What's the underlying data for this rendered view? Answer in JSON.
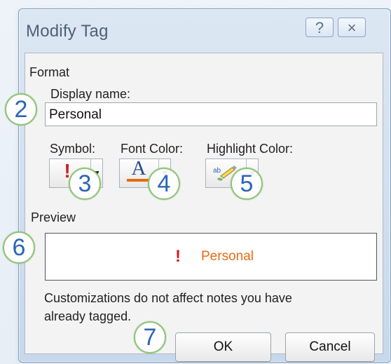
{
  "dialog": {
    "title": "Modify Tag",
    "help_label": "?",
    "close_label": "×"
  },
  "format": {
    "section_label": "Format",
    "display_name_label": "Display name:",
    "display_name_value": "Personal",
    "symbol_label": "Symbol:",
    "font_color_label": "Font Color:",
    "highlight_color_label": "Highlight Color:"
  },
  "preview": {
    "section_label": "Preview",
    "symbol": "!",
    "text": "Personal"
  },
  "note": "Customizations do not affect notes you have already tagged.",
  "buttons": {
    "ok_label": "OK",
    "cancel_label": "Cancel"
  },
  "callouts": [
    "2",
    "3",
    "4",
    "5",
    "6",
    "7"
  ],
  "icons": {
    "symbol_icon": "exclamation-icon",
    "font_color_icon": "font-color-icon",
    "highlight_icon": "highlighter-icon",
    "dropdown_icon": "chevron-down-icon"
  },
  "colors": {
    "symbol_red": "#cf1d1d",
    "preview_orange": "#ea6a12",
    "font_blue": "#284b8a",
    "font_underline_orange": "#e46c0a",
    "callout_blue": "#2c66b6",
    "callout_green": "#8fc37a"
  }
}
